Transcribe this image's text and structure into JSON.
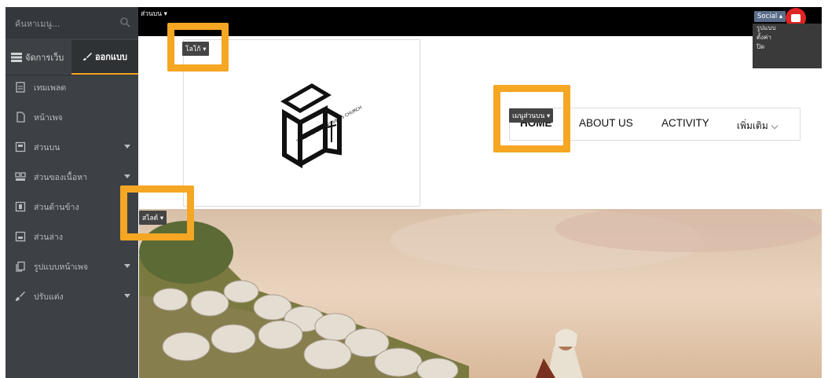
{
  "sidebar": {
    "search_placeholder": "ค้นหาเมนู...",
    "tabs": [
      {
        "label": "จัดการเว็บ",
        "icon": "list-icon"
      },
      {
        "label": "ออกแบบ",
        "icon": "brush-icon"
      }
    ],
    "items": [
      {
        "label": "เทมเพลต",
        "icon": "template-icon"
      },
      {
        "label": "หน้าเพจ",
        "icon": "page-icon"
      },
      {
        "label": "ส่วนบน",
        "icon": "header-section-icon"
      },
      {
        "label": "ส่วนของเนื้อหา",
        "icon": "content-section-icon"
      },
      {
        "label": "ส่วนด้านข้าง",
        "icon": "side-section-icon"
      },
      {
        "label": "ส่วนล่าง",
        "icon": "footer-section-icon"
      },
      {
        "label": "รูปแบบหน้าเพจ",
        "icon": "page-layout-icon"
      },
      {
        "label": "ปรับแต่ง",
        "icon": "customize-icon"
      }
    ]
  },
  "topbar": {
    "section_label": "ส่วนบน",
    "social_label": "Social",
    "social_menu": [
      "รูปแบบ",
      "ตั้งค่า",
      "ปิด"
    ]
  },
  "editor": {
    "logo_label": "โลโก้",
    "menu_label": "เมนูส่วนบน",
    "slide_label": "สไลด์"
  },
  "site": {
    "logo_text": "STREAMS OF BLESSINGS CHURCH",
    "menu": [
      "HOME",
      "ABOUT US",
      "ACTIVITY",
      "เพิ่มเติม"
    ]
  },
  "colors": {
    "highlight": "#f5a623",
    "sidebar_bg": "#3d4145",
    "topbar_bg": "#000000"
  }
}
